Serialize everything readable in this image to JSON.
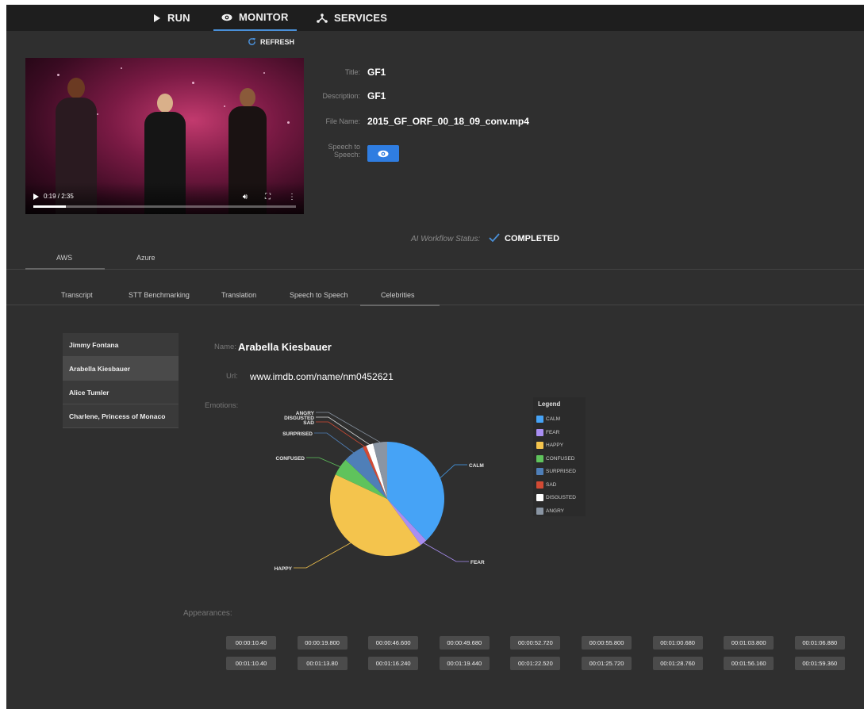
{
  "nav": {
    "run": "RUN",
    "monitor": "MONITOR",
    "services": "SERVICES"
  },
  "refresh_label": "REFRESH",
  "video": {
    "time": "0:19 / 2:35",
    "progress": 0.123
  },
  "meta": {
    "title_label": "Title:",
    "title_value": "GF1",
    "description_label": "Description:",
    "description_value": "GF1",
    "filename_label": "File Name:",
    "filename_value": "2015_GF_ORF_00_18_09_conv.mp4",
    "s2s_label_line1": "Speech to",
    "s2s_label_line2": "Speech:"
  },
  "status": {
    "label": "AI Workflow Status:",
    "value": "COMPLETED"
  },
  "provider_tabs": [
    "AWS",
    "Azure"
  ],
  "feature_tabs": [
    "Transcript",
    "STT Benchmarking",
    "Translation",
    "Speech to Speech",
    "Celebrities"
  ],
  "celebrities": [
    "Jimmy Fontana",
    "Arabella Kiesbauer",
    "Alice Tumler",
    "Charlene, Princess of Monaco"
  ],
  "selected_celebrity_index": 1,
  "detail": {
    "name_label": "Name:",
    "name_value": "Arabella Kiesbauer",
    "url_label": "Url:",
    "url_value": "www.imdb.com/name/nm0452621",
    "emotions_label": "Emotions:",
    "appearances_label": "Appearances:"
  },
  "legend_title": "Legend",
  "chart_data": {
    "type": "pie",
    "title": "",
    "slices": [
      {
        "label": "CALM",
        "value": 38,
        "color": "#46a3f6"
      },
      {
        "label": "FEAR",
        "value": 2,
        "color": "#a98ef2"
      },
      {
        "label": "HAPPY",
        "value": 42,
        "color": "#f4c44d"
      },
      {
        "label": "CONFUSED",
        "value": 5,
        "color": "#5fc35c"
      },
      {
        "label": "SURPRISED",
        "value": 6,
        "color": "#4f7fb8"
      },
      {
        "label": "SAD",
        "value": 1,
        "color": "#d24a34"
      },
      {
        "label": "DISGUSTED",
        "value": 2,
        "color": "#ffffff"
      },
      {
        "label": "ANGRY",
        "value": 4,
        "color": "#8a95a3"
      }
    ],
    "legend_placement": "right"
  },
  "appearances": [
    "00:00:10.40",
    "00:00:19.800",
    "00:00:46.600",
    "00:00:49.680",
    "00:00:52.720",
    "00:00:55.800",
    "00:01:00.680",
    "00:01:03.800",
    "00:01:06.880",
    "00:01:10.40",
    "00:01:13.80",
    "00:01:16.240",
    "00:01:19.440",
    "00:01:22.520",
    "00:01:25.720",
    "00:01:28.760",
    "00:01:56.160",
    "00:01:59.360"
  ]
}
